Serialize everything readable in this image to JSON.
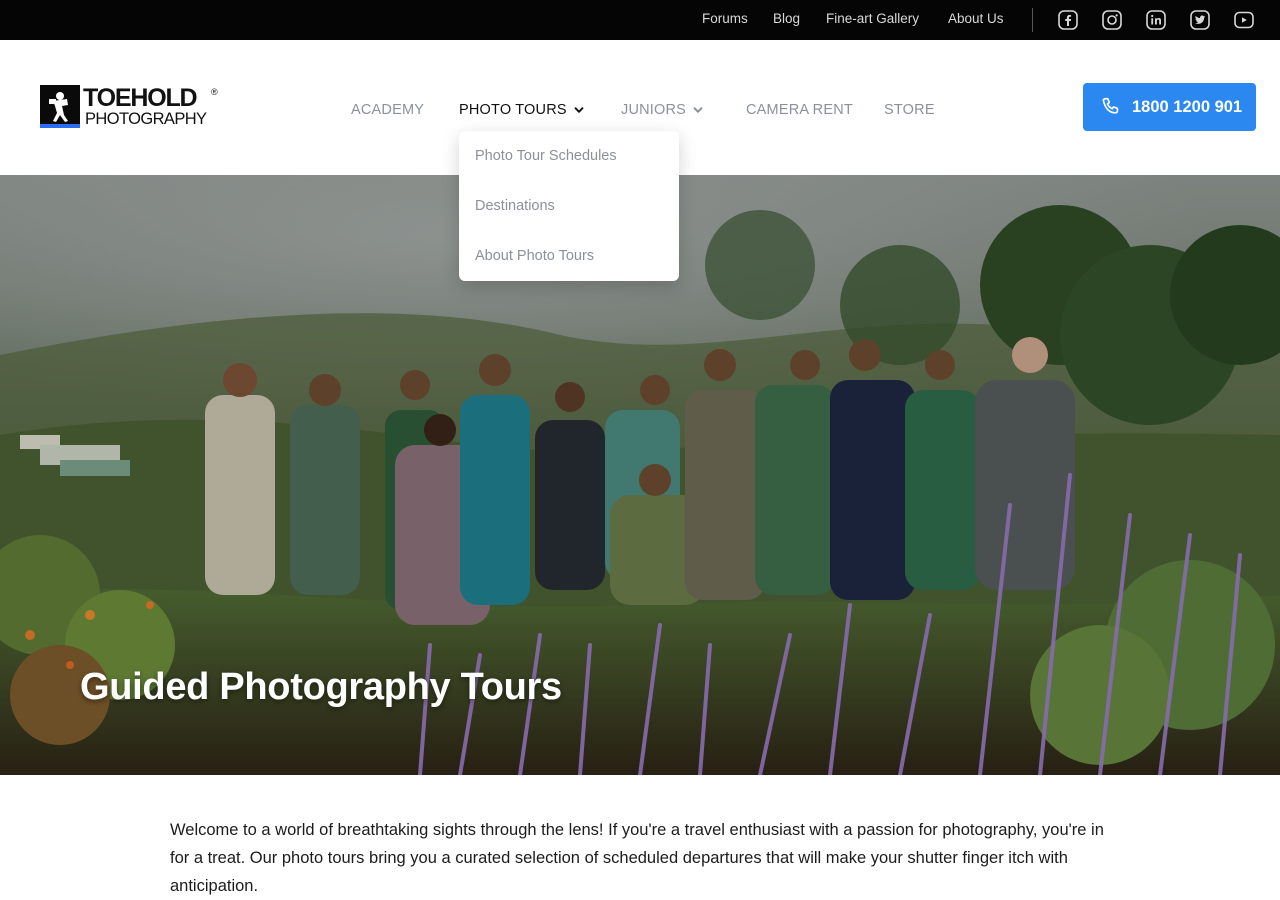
{
  "topbar": {
    "links": [
      "Forums",
      "Blog",
      "Fine-art Gallery",
      "About Us"
    ],
    "social_icons": [
      "facebook-icon",
      "instagram-icon",
      "linkedin-icon",
      "twitter-icon",
      "youtube-icon"
    ]
  },
  "header": {
    "logo": {
      "line1": "TOEHOLD",
      "line2": "PHOTOGRAPHY",
      "registered": "®"
    },
    "nav": [
      {
        "label": "ACADEMY",
        "has_dropdown": false,
        "active": false
      },
      {
        "label": "PHOTO TOURS",
        "has_dropdown": true,
        "active": true
      },
      {
        "label": "JUNIORS",
        "has_dropdown": true,
        "active": false
      },
      {
        "label": "CAMERA RENT",
        "has_dropdown": false,
        "active": false
      },
      {
        "label": "STORE",
        "has_dropdown": false,
        "active": false
      }
    ],
    "phone": {
      "icon": "phone-icon",
      "number": "1800 1200 901"
    }
  },
  "dropdown": {
    "items": [
      "Photo Tour Schedules",
      "Destinations",
      "About Photo Tours"
    ]
  },
  "hero": {
    "title": "Guided Photography Tours"
  },
  "intro": {
    "text": "Welcome to a world of breathtaking sights through the lens! If you're a travel enthusiast with a passion for photography, you're in for a treat. Our photo tours bring you a curated selection of scheduled departures that will make your shutter finger itch with anticipation."
  },
  "colors": {
    "accent": "#2b88f0",
    "topbar_bg": "#050505",
    "nav_muted": "#8c9199"
  }
}
